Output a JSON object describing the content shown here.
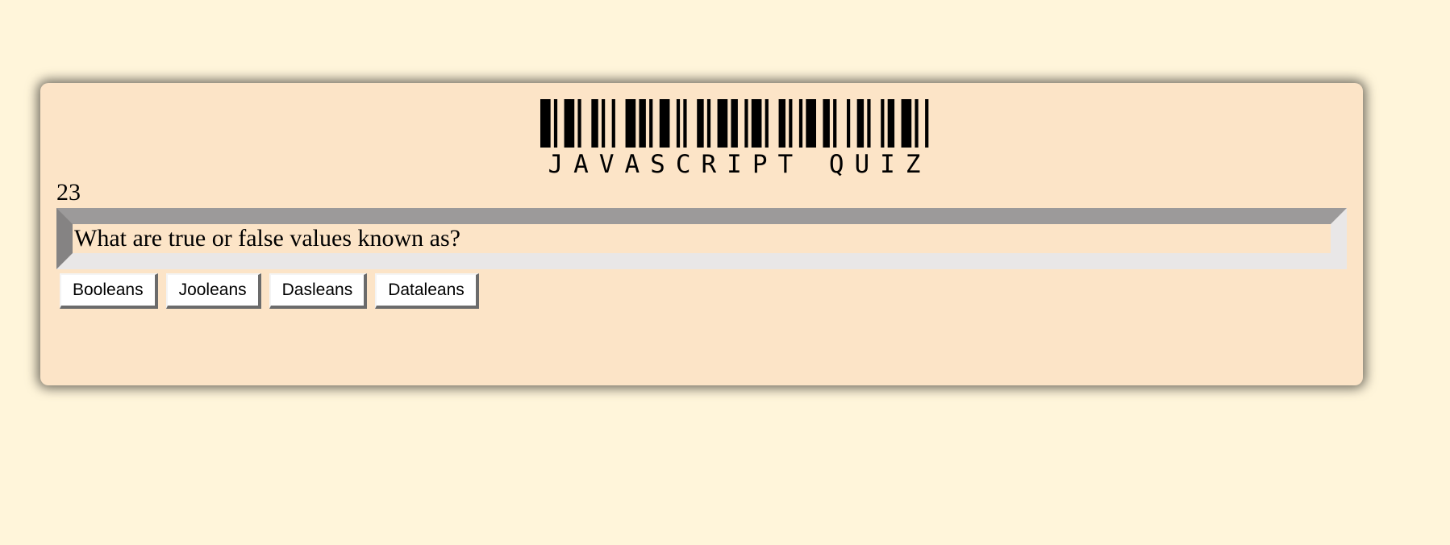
{
  "logo": {
    "text": "JAVASCRIPT QUIZ"
  },
  "quiz": {
    "question_number": "23",
    "question": "What are true or false values known as?",
    "answers": [
      "Booleans",
      "Jooleans",
      "Dasleans",
      "Dataleans"
    ]
  },
  "colors": {
    "page_background": "#fff5da",
    "card_background": "#fce4c7",
    "button_background": "#ffffff"
  },
  "icons": {
    "logo_graphic": "barcode"
  }
}
